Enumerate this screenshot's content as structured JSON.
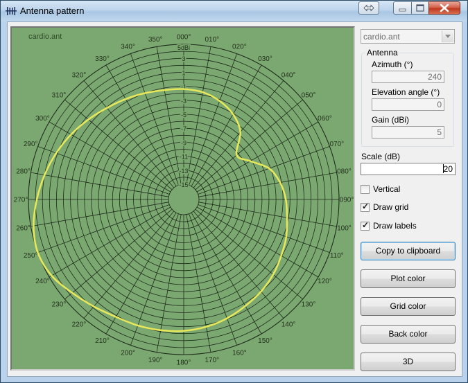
{
  "window": {
    "title": "Antenna pattern"
  },
  "plot": {
    "filename": "cardio.ant",
    "unit_label": "5dBi",
    "azimuth_labels": [
      "000",
      "010",
      "020",
      "030",
      "040",
      "050",
      "060",
      "070",
      "080",
      "090",
      "100",
      "110",
      "120",
      "130",
      "140",
      "150",
      "160",
      "170",
      "180",
      "190",
      "200",
      "210",
      "220",
      "230",
      "240",
      "250",
      "260",
      "270",
      "280",
      "290",
      "300",
      "310",
      "320",
      "330",
      "340",
      "350"
    ],
    "gain_labels": [
      "3",
      "1",
      "-1",
      "-3",
      "-5",
      "-7",
      "-9",
      "-11",
      "-13",
      "-15"
    ],
    "colors": {
      "background": "#7ba870",
      "grid": "#1e2a1c",
      "plot": "#e8e85a",
      "label": "#24311f"
    }
  },
  "chart_data": {
    "type": "line",
    "coordinate_system": "polar",
    "title": "",
    "angle_unit": "degrees",
    "radius_unit": "dBi",
    "radial_range": [
      -15,
      5
    ],
    "radial_ticks": [
      5,
      3,
      1,
      -1,
      -3,
      -5,
      -7,
      -9,
      -11,
      -13,
      -15
    ],
    "angle_ticks_step": 10,
    "grid": true,
    "series": [
      {
        "angles": [
          0,
          10,
          20,
          30,
          40,
          50,
          60,
          70,
          80,
          90,
          100,
          110,
          120,
          130,
          140,
          150,
          160,
          170,
          180,
          190,
          200,
          210,
          220,
          230,
          240,
          250,
          260,
          270,
          280,
          290,
          300,
          310,
          320,
          330,
          340,
          350
        ],
        "gain_dbi": [
          -1.4,
          -1.6,
          -2.2,
          -3.1,
          -4.6,
          -7.3,
          -6.2,
          -4.2,
          -3.2,
          -2.6,
          -2.2,
          -1.6,
          -1.1,
          -0.5,
          0.0,
          0.4,
          0.9,
          1.3,
          1.6,
          1.8,
          2.0,
          2.2,
          2.8,
          3.6,
          4.6,
          5.0,
          4.6,
          3.8,
          3.0,
          2.2,
          1.4,
          0.6,
          -0.1,
          -0.6,
          -1.0,
          -1.3
        ]
      }
    ]
  },
  "sidebar": {
    "file_select": {
      "value": "cardio.ant"
    },
    "antenna_group": {
      "legend": "Antenna",
      "azimuth_label": "Azimuth (°)",
      "azimuth_value": "240",
      "elevation_label": "Elevation angle (°)",
      "elevation_value": "0",
      "gain_label": "Gain (dBi)",
      "gain_value": "5"
    },
    "scale_label": "Scale (dB)",
    "scale_value": "20",
    "checkboxes": {
      "vertical": {
        "label": "Vertical",
        "checked": false
      },
      "draw_grid": {
        "label": "Draw grid",
        "checked": true
      },
      "draw_labels": {
        "label": "Draw labels",
        "checked": true
      }
    },
    "buttons": {
      "copy": "Copy to clipboard",
      "plot_color": "Plot color",
      "grid_color": "Grid color",
      "back_color": "Back color",
      "three_d": "3D"
    }
  }
}
